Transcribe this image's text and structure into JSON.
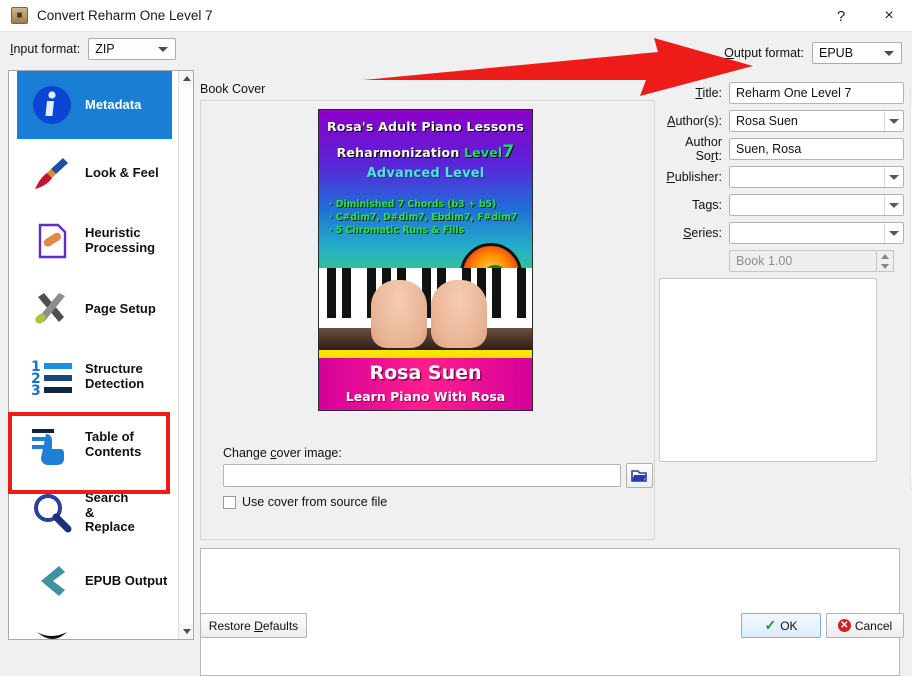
{
  "window": {
    "title": "Convert Reharm One Level 7",
    "app_icon": "book-icon",
    "help_label": "?",
    "close_label": "×"
  },
  "toolbar": {
    "input_format_label": "Input format:",
    "input_format_value": "ZIP",
    "output_format_label": "Output format:",
    "output_format_value": "EPUB"
  },
  "sidebar": {
    "items": [
      {
        "label": "Metadata",
        "icon": "info-circle-icon",
        "selected": true
      },
      {
        "label": "Look & Feel",
        "icon": "paintbrush-icon",
        "selected": false
      },
      {
        "label": "Heuristic\nProcessing",
        "icon": "document-bandage-icon",
        "selected": false
      },
      {
        "label": "Page Setup",
        "icon": "wrench-screwdriver-icon",
        "selected": false
      },
      {
        "label": "Structure\nDetection",
        "icon": "numbered-list-icon",
        "selected": false
      },
      {
        "label": "Table of\nContents",
        "icon": "toc-hand-icon",
        "selected": false,
        "highlighted": true
      },
      {
        "label": "Search\n&\nReplace",
        "icon": "magnifier-icon",
        "selected": false
      },
      {
        "label": "EPUB Output",
        "icon": "chevron-left-icon",
        "selected": false
      }
    ]
  },
  "main": {
    "book_cover_label": "Book Cover",
    "change_cover_label": "Change cover image:",
    "change_cover_value": "",
    "browse_icon": "folder-open-icon",
    "use_cover_label": "Use cover from source file"
  },
  "cover": {
    "line1": "Rosa's  Adult Piano Lessons",
    "line2_a": "Reharmonization ",
    "line2_b": "Level",
    "line2_num": "7",
    "line3": "Advanced Level",
    "bullets": [
      "·  Diminished 7 Chords (b3 + b5)",
      "·  C#dim7, D#dim7, Ebdim7, F#dim7",
      "·  5 Chromatic Runs & Fills"
    ],
    "author_name": "Rosa Suen",
    "tagline": "Learn Piano With Rosa"
  },
  "metadata": {
    "fields": [
      {
        "label": "Title:",
        "value": "Reharm One Level 7",
        "type": "text"
      },
      {
        "label": "Author(s):",
        "value": "Rosa Suen",
        "type": "combo"
      },
      {
        "label": "Author Sort:",
        "value": "Suen, Rosa",
        "type": "text"
      },
      {
        "label": "Publisher:",
        "value": "",
        "type": "combo"
      },
      {
        "label": "Tags:",
        "value": "",
        "type": "combo"
      },
      {
        "label": "Series:",
        "value": "",
        "type": "combo"
      }
    ],
    "series_index_value": "Book 1.00",
    "comments_value": ""
  },
  "footer": {
    "restore_label": "Restore Defaults",
    "ok_label": "OK",
    "cancel_label": "Cancel"
  },
  "annotation": {
    "arrow_color": "#ee1c18",
    "highlight_color": "#ee1c18"
  }
}
